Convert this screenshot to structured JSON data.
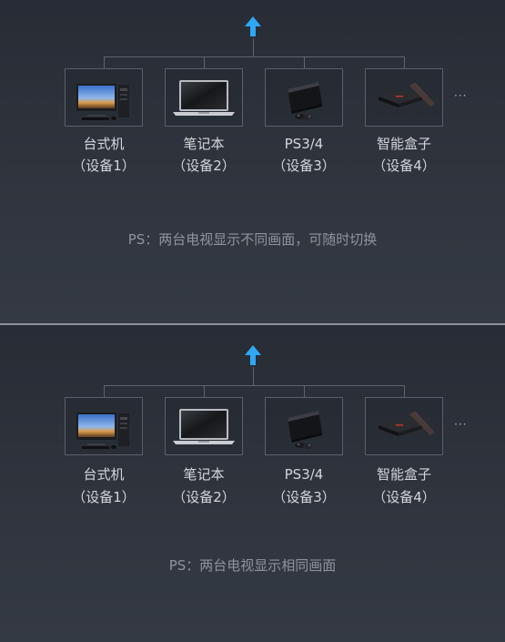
{
  "sections": [
    {
      "devices": [
        {
          "name": "台式机",
          "sub": "（设备1）",
          "icon": "desktop-computer-icon"
        },
        {
          "name": "笔记本",
          "sub": "（设备2）",
          "icon": "laptop-icon"
        },
        {
          "name": "PS3/4",
          "sub": "（设备3）",
          "icon": "game-console-icon"
        },
        {
          "name": "智能盒子",
          "sub": "（设备4）",
          "icon": "tv-box-icon"
        }
      ],
      "ellipsis": "···",
      "note": "PS：两台电视显示不同画面，可随时切换"
    },
    {
      "devices": [
        {
          "name": "台式机",
          "sub": "（设备1）",
          "icon": "desktop-computer-icon"
        },
        {
          "name": "笔记本",
          "sub": "（设备2）",
          "icon": "laptop-icon"
        },
        {
          "name": "PS3/4",
          "sub": "（设备3）",
          "icon": "game-console-icon"
        },
        {
          "name": "智能盒子",
          "sub": "（设备4）",
          "icon": "tv-box-icon"
        }
      ],
      "ellipsis": "···",
      "note": "PS：两台电视显示相同画面"
    }
  ],
  "colors": {
    "arrow": "#2fa8f5",
    "line": "#5e646e",
    "background": "#2a2f38"
  }
}
